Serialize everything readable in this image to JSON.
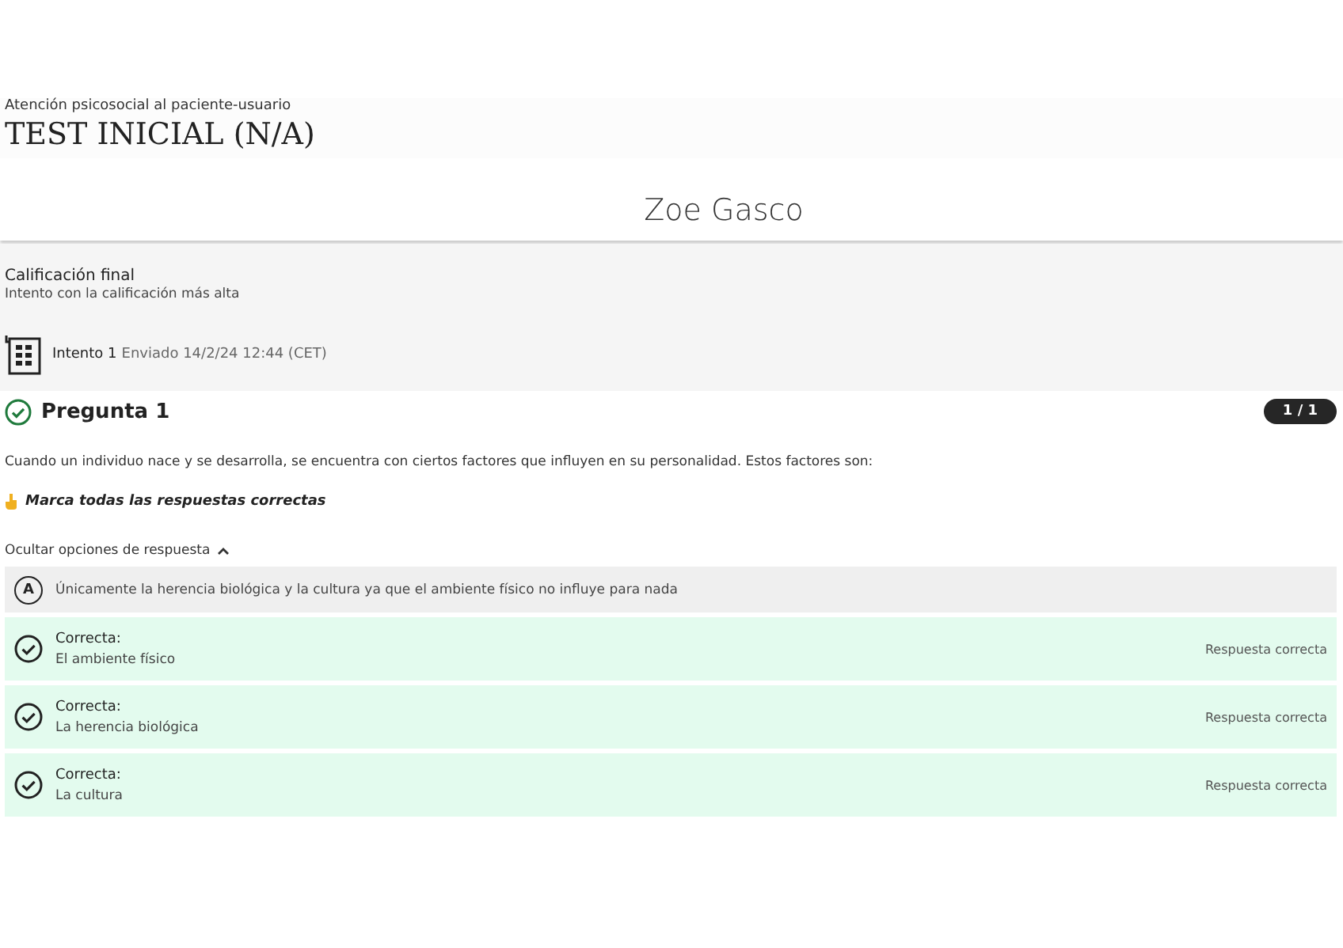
{
  "course": "Atención psicosocial al paciente-usuario",
  "title": "TEST INICIAL (N/A)",
  "student": "Zoe Gasco",
  "grade": {
    "label": "Calificación final",
    "note": "Intento con la calificación más alta"
  },
  "attempt": {
    "label": "Intento 1",
    "submitted": "Enviado 14/2/24 12:44 (CET)"
  },
  "question": {
    "title": "Pregunta 1",
    "correct": true,
    "score": "1 / 1",
    "text": "Cuando un individuo nace y se desarrolla, se encuentra con ciertos factores que influyen en su personalidad. Estos factores son:",
    "instruction": "Marca todas las respuestas correctas",
    "toggle": {
      "label": "Ocultar opciones de respuesta",
      "expanded": true
    },
    "options": [
      {
        "kind": "letter",
        "letter": "A",
        "text": "Únicamente la herencia biológica y la cultura ya que el ambiente físico no influye para nada"
      },
      {
        "kind": "correct",
        "status": "Correcta:",
        "text": "El ambiente físico",
        "feedback": "Respuesta correcta"
      },
      {
        "kind": "correct",
        "status": "Correcta:",
        "text": "La herencia biológica",
        "feedback": "Respuesta correcta"
      },
      {
        "kind": "correct",
        "status": "Correcta:",
        "text": "La cultura",
        "feedback": "Respuesta correcta"
      }
    ]
  }
}
